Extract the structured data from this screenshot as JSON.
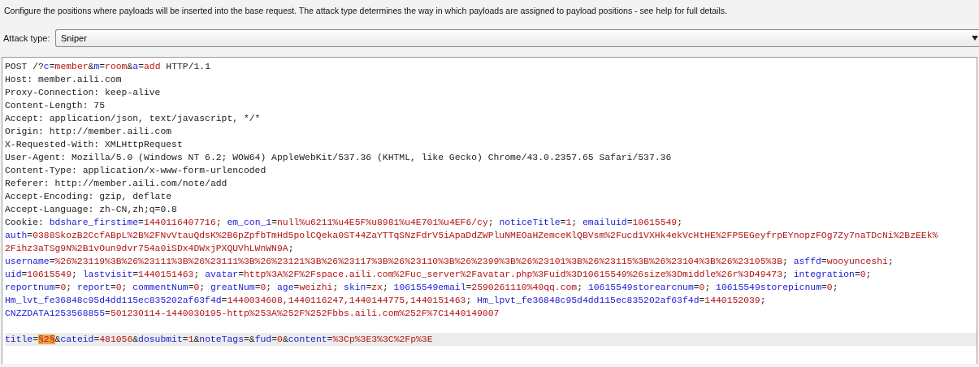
{
  "description": "Configure the positions where payloads will be inserted into the base request. The attack type determines the way in which payloads are assigned to payload positions - see help for full details.",
  "attack_type": {
    "label": "Attack type:",
    "value": "Sniper"
  },
  "request_lines": [
    {
      "kind": "text",
      "current": false,
      "segments": [
        {
          "kind": "plain",
          "text": "POST /?"
        },
        {
          "kind": "name",
          "text": "c"
        },
        {
          "kind": "plain",
          "text": "="
        },
        {
          "kind": "value",
          "text": "member"
        },
        {
          "kind": "plain",
          "text": "&"
        },
        {
          "kind": "name",
          "text": "m"
        },
        {
          "kind": "plain",
          "text": "="
        },
        {
          "kind": "value",
          "text": "room"
        },
        {
          "kind": "plain",
          "text": "&"
        },
        {
          "kind": "name",
          "text": "a"
        },
        {
          "kind": "plain",
          "text": "="
        },
        {
          "kind": "value",
          "text": "add"
        },
        {
          "kind": "plain",
          "text": " HTTP/1.1"
        }
      ]
    },
    {
      "kind": "text",
      "current": false,
      "segments": [
        {
          "kind": "plain",
          "text": "Host: member.aili.com"
        }
      ]
    },
    {
      "kind": "text",
      "current": false,
      "segments": [
        {
          "kind": "plain",
          "text": "Proxy-Connection: keep-alive"
        }
      ]
    },
    {
      "kind": "text",
      "current": false,
      "segments": [
        {
          "kind": "plain",
          "text": "Content-Length: 75"
        }
      ]
    },
    {
      "kind": "text",
      "current": false,
      "segments": [
        {
          "kind": "plain",
          "text": "Accept: application/json, text/javascript, */*"
        }
      ]
    },
    {
      "kind": "text",
      "current": false,
      "segments": [
        {
          "kind": "plain",
          "text": "Origin: http://member.aili.com"
        }
      ]
    },
    {
      "kind": "text",
      "current": false,
      "segments": [
        {
          "kind": "plain",
          "text": "X-Requested-With: XMLHttpRequest"
        }
      ]
    },
    {
      "kind": "text",
      "current": false,
      "segments": [
        {
          "kind": "plain",
          "text": "User-Agent: Mozilla/5.0 (Windows NT 6.2; WOW64) AppleWebKit/537.36 (KHTML, like Gecko) Chrome/43.0.2357.65 Safari/537.36"
        }
      ]
    },
    {
      "kind": "text",
      "current": false,
      "segments": [
        {
          "kind": "plain",
          "text": "Content-Type: application/x-www-form-urlencoded"
        }
      ]
    },
    {
      "kind": "text",
      "current": false,
      "segments": [
        {
          "kind": "plain",
          "text": "Referer: http://member.aili.com/note/add"
        }
      ]
    },
    {
      "kind": "text",
      "current": false,
      "segments": [
        {
          "kind": "plain",
          "text": "Accept-Encoding: gzip, deflate"
        }
      ]
    },
    {
      "kind": "text",
      "current": false,
      "segments": [
        {
          "kind": "plain",
          "text": "Accept-Language: zh-CN,zh;q=0.8"
        }
      ]
    },
    {
      "kind": "text",
      "current": false,
      "segments": [
        {
          "kind": "plain",
          "text": "Cookie: "
        },
        {
          "kind": "name",
          "text": "bdshare_firstime"
        },
        {
          "kind": "plain",
          "text": "="
        },
        {
          "kind": "value",
          "text": "1440116407716"
        },
        {
          "kind": "plain",
          "text": "; "
        },
        {
          "kind": "name",
          "text": "em_con_1"
        },
        {
          "kind": "plain",
          "text": "="
        },
        {
          "kind": "value",
          "text": "null%u6211%u4E5F%u8981%u4E701%u4EF6/cy"
        },
        {
          "kind": "plain",
          "text": "; "
        },
        {
          "kind": "name",
          "text": "noticeTitle"
        },
        {
          "kind": "plain",
          "text": "="
        },
        {
          "kind": "value",
          "text": "1"
        },
        {
          "kind": "plain",
          "text": "; "
        },
        {
          "kind": "name",
          "text": "emailuid"
        },
        {
          "kind": "plain",
          "text": "="
        },
        {
          "kind": "value",
          "text": "10615549"
        },
        {
          "kind": "plain",
          "text": ";"
        }
      ]
    },
    {
      "kind": "text",
      "current": false,
      "segments": [
        {
          "kind": "name",
          "text": "auth"
        },
        {
          "kind": "plain",
          "text": "="
        },
        {
          "kind": "value",
          "text": "0388SkozB2CcfABpL%2B%2FNvVtauQdsK%2B6pZpfbTmHd5polCQeka0ST44ZaYTTqSNzFdrV5iApaDdZWPluNMEOaHZemceKlQBVsm%2Fucd1VXHk4ekVcHtHE%2FP5EGeyfrpEYnopzFOg7Zy7naTDcNi%2BzEEk%"
        }
      ]
    },
    {
      "kind": "text",
      "current": false,
      "segments": [
        {
          "kind": "value",
          "text": "2Fihz3aTSg9N%2B1vOun9dvr754a0iSDx4DWxjPXQUVhLWnWN9A"
        },
        {
          "kind": "plain",
          "text": ";"
        }
      ]
    },
    {
      "kind": "text",
      "current": false,
      "segments": [
        {
          "kind": "name",
          "text": "username"
        },
        {
          "kind": "plain",
          "text": "="
        },
        {
          "kind": "value",
          "text": "%26%23119%3B%26%23111%3B%26%23111%3B%26%23121%3B%26%23117%3B%26%23110%3B%26%2399%3B%26%23101%3B%26%23115%3B%26%23104%3B%26%23105%3B"
        },
        {
          "kind": "plain",
          "text": "; "
        },
        {
          "kind": "name",
          "text": "asffd"
        },
        {
          "kind": "plain",
          "text": "="
        },
        {
          "kind": "value",
          "text": "wooyunceshi"
        },
        {
          "kind": "plain",
          "text": ";"
        }
      ]
    },
    {
      "kind": "text",
      "current": false,
      "segments": [
        {
          "kind": "name",
          "text": "uid"
        },
        {
          "kind": "plain",
          "text": "="
        },
        {
          "kind": "value",
          "text": "10615549"
        },
        {
          "kind": "plain",
          "text": "; "
        },
        {
          "kind": "name",
          "text": "lastvisit"
        },
        {
          "kind": "plain",
          "text": "="
        },
        {
          "kind": "value",
          "text": "1440151463"
        },
        {
          "kind": "plain",
          "text": "; "
        },
        {
          "kind": "name",
          "text": "avatar"
        },
        {
          "kind": "plain",
          "text": "="
        },
        {
          "kind": "value",
          "text": "http%3A%2F%2Fspace.aili.com%2Fuc_server%2Favatar.php%3Fuid%3D10615549%26size%3Dmiddle%26r%3D49473"
        },
        {
          "kind": "plain",
          "text": "; "
        },
        {
          "kind": "name",
          "text": "integration"
        },
        {
          "kind": "plain",
          "text": "="
        },
        {
          "kind": "value",
          "text": "0"
        },
        {
          "kind": "plain",
          "text": ";"
        }
      ]
    },
    {
      "kind": "text",
      "current": false,
      "segments": [
        {
          "kind": "name",
          "text": "reportnum"
        },
        {
          "kind": "plain",
          "text": "="
        },
        {
          "kind": "value",
          "text": "0"
        },
        {
          "kind": "plain",
          "text": "; "
        },
        {
          "kind": "name",
          "text": "report"
        },
        {
          "kind": "plain",
          "text": "="
        },
        {
          "kind": "value",
          "text": "0"
        },
        {
          "kind": "plain",
          "text": "; "
        },
        {
          "kind": "name",
          "text": "commentNum"
        },
        {
          "kind": "plain",
          "text": "="
        },
        {
          "kind": "value",
          "text": "0"
        },
        {
          "kind": "plain",
          "text": "; "
        },
        {
          "kind": "name",
          "text": "greatNum"
        },
        {
          "kind": "plain",
          "text": "="
        },
        {
          "kind": "value",
          "text": "0"
        },
        {
          "kind": "plain",
          "text": "; "
        },
        {
          "kind": "name",
          "text": "age"
        },
        {
          "kind": "plain",
          "text": "="
        },
        {
          "kind": "value",
          "text": "weizhi"
        },
        {
          "kind": "plain",
          "text": "; "
        },
        {
          "kind": "name",
          "text": "skin"
        },
        {
          "kind": "plain",
          "text": "="
        },
        {
          "kind": "value",
          "text": "zx"
        },
        {
          "kind": "plain",
          "text": "; "
        },
        {
          "kind": "name",
          "text": "10615549email"
        },
        {
          "kind": "plain",
          "text": "="
        },
        {
          "kind": "value",
          "text": "2590261110%40qq.com"
        },
        {
          "kind": "plain",
          "text": "; "
        },
        {
          "kind": "name",
          "text": "10615549storearcnum"
        },
        {
          "kind": "plain",
          "text": "="
        },
        {
          "kind": "value",
          "text": "0"
        },
        {
          "kind": "plain",
          "text": "; "
        },
        {
          "kind": "name",
          "text": "10615549storepicnum"
        },
        {
          "kind": "plain",
          "text": "="
        },
        {
          "kind": "value",
          "text": "0"
        },
        {
          "kind": "plain",
          "text": ";"
        }
      ]
    },
    {
      "kind": "text",
      "current": false,
      "segments": [
        {
          "kind": "name",
          "text": "Hm_lvt_fe36848c95d4dd115ec835202af63f4d"
        },
        {
          "kind": "plain",
          "text": "="
        },
        {
          "kind": "value",
          "text": "1440034608,1440116247,1440144775,1440151463"
        },
        {
          "kind": "plain",
          "text": "; "
        },
        {
          "kind": "name",
          "text": "Hm_lpvt_fe36848c95d4dd115ec835202af63f4d"
        },
        {
          "kind": "plain",
          "text": "="
        },
        {
          "kind": "value",
          "text": "1440152039"
        },
        {
          "kind": "plain",
          "text": ";"
        }
      ]
    },
    {
      "kind": "text",
      "current": false,
      "segments": [
        {
          "kind": "name",
          "text": "CNZZDATA1253568855"
        },
        {
          "kind": "plain",
          "text": "="
        },
        {
          "kind": "value",
          "text": "501230114-1440030195-http%253A%252F%252Fbbs.aili.com%252F%7C1440149007"
        }
      ]
    },
    {
      "kind": "blank"
    },
    {
      "kind": "text",
      "current": true,
      "segments": [
        {
          "kind": "name",
          "text": "title"
        },
        {
          "kind": "plain",
          "text": "="
        },
        {
          "kind": "payload",
          "text": "§2§"
        },
        {
          "kind": "plain",
          "text": "&"
        },
        {
          "kind": "name",
          "text": "cateid"
        },
        {
          "kind": "plain",
          "text": "="
        },
        {
          "kind": "value",
          "text": "481056"
        },
        {
          "kind": "plain",
          "text": "&"
        },
        {
          "kind": "name",
          "text": "dosubmit"
        },
        {
          "kind": "plain",
          "text": "="
        },
        {
          "kind": "value",
          "text": "1"
        },
        {
          "kind": "plain",
          "text": "&"
        },
        {
          "kind": "name",
          "text": "noteTags"
        },
        {
          "kind": "plain",
          "text": "=&"
        },
        {
          "kind": "name",
          "text": "fud"
        },
        {
          "kind": "plain",
          "text": "="
        },
        {
          "kind": "value",
          "text": "0"
        },
        {
          "kind": "plain",
          "text": "&"
        },
        {
          "kind": "name",
          "text": "content"
        },
        {
          "kind": "plain",
          "text": "="
        },
        {
          "kind": "value",
          "text": "%3Cp%3E3%3C%2Fp%3E"
        }
      ]
    }
  ]
}
